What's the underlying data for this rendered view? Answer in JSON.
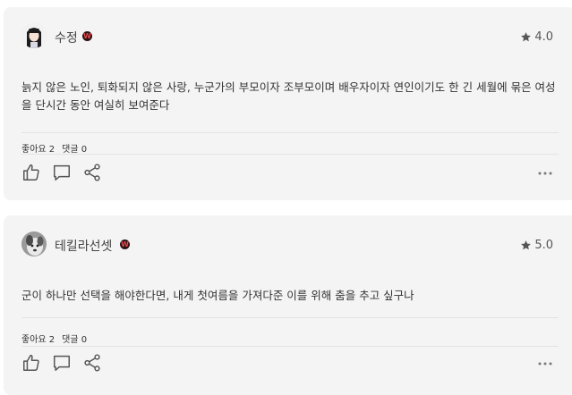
{
  "reviews": [
    {
      "author": "수정",
      "badge": "W",
      "rating": "4.0",
      "text": "늙지 않은 노인, 퇴화되지 않은 사랑, 누군가의 부모이자 조부모이며 배우자이자 연인이기도 한 긴 세월에 묶은 여성을 단시간 동안 여실히 보여준다",
      "likes_label": "좋아요 2",
      "comments_label": "댓글 0"
    },
    {
      "author": "테킬라선셋",
      "badge": "W",
      "rating": "5.0",
      "text": "군이 하나만 선택을 해야한다면, 내게 첫여름을 가져다준 이를 위해 춤을 추고 싶구나",
      "likes_label": "좋아요 2",
      "comments_label": "댓글 0"
    }
  ],
  "icons": {
    "star": "star-icon",
    "like": "thumbs-up-icon",
    "comment": "comment-icon",
    "share": "share-icon",
    "more": "more-icon"
  },
  "colors": {
    "card_bg": "#f4f4f5",
    "badge_bg": "#2a1215",
    "badge_fg": "#e24b4b",
    "icon": "#555555"
  }
}
